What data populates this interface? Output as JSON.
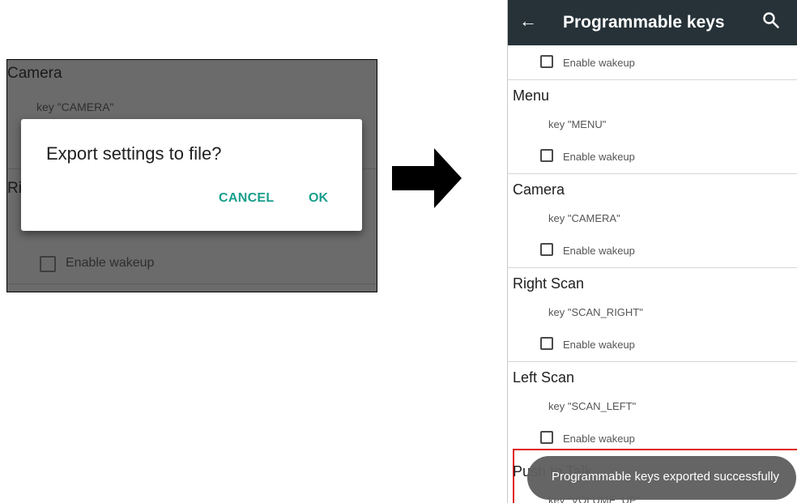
{
  "left_panel": {
    "bg_title_1": "Camera",
    "bg_sub_1": "key \"CAMERA\"",
    "bg_title_2": "Ri",
    "bg_checkbox_label": "Enable wakeup",
    "dialog": {
      "title": "Export settings to file?",
      "cancel_label": "CANCEL",
      "ok_label": "OK"
    }
  },
  "right_panel": {
    "appbar": {
      "back_icon": "←",
      "title": "Programmable keys",
      "search_icon": "search-icon"
    },
    "first_checkbox_label": "Enable wakeup",
    "items": [
      {
        "title": "Menu",
        "key": "key \"MENU\"",
        "checkbox_label": "Enable wakeup"
      },
      {
        "title": "Camera",
        "key": "key \"CAMERA\"",
        "checkbox_label": "Enable wakeup"
      },
      {
        "title": "Right Scan",
        "key": "key \"SCAN_RIGHT\"",
        "checkbox_label": "Enable wakeup"
      },
      {
        "title": "Left Scan",
        "key": "key \"SCAN_LEFT\"",
        "checkbox_label": "Enable wakeup"
      }
    ],
    "partial_item": {
      "title": "Push to Talk",
      "key": "key \"VOLUME_UP\""
    },
    "toast": "Programmable keys exported successfully"
  },
  "colors": {
    "accent": "#1a9e8c",
    "appbar": "#263238",
    "highlight": "#e01e1e",
    "toast": "#5f5f5f"
  }
}
